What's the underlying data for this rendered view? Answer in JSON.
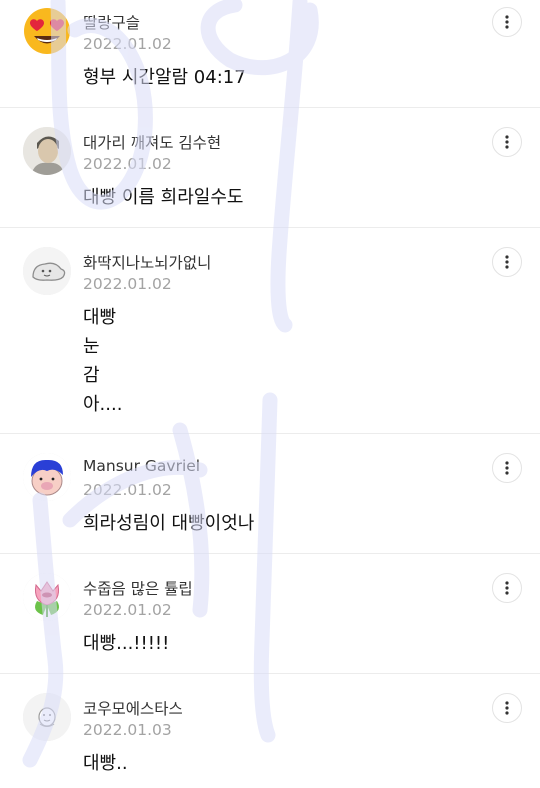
{
  "comments": [
    {
      "author": "딸랑구슬",
      "date": "2022.01.02",
      "text": "형부 시간알람 04:17",
      "avatar": "heart-eyes-emoji"
    },
    {
      "author": "대가리 깨져도 김수현",
      "date": "2022.01.02",
      "text": "대빵 이름 희라일수도",
      "avatar": "actor-photo"
    },
    {
      "author": "화딱지나노뇌가없니",
      "date": "2022.01.02",
      "text": "대빵\n눈\n감\n아....",
      "avatar": "cartoon-creature"
    },
    {
      "author": "Mansur Gavriel",
      "date": "2022.01.02",
      "text": "희라성림이 대빵이엇나",
      "avatar": "blue-hair-character"
    },
    {
      "author": "수줍음 많은 튤립",
      "date": "2022.01.02",
      "text": "대빵...!!!!!",
      "avatar": "tulip-character"
    },
    {
      "author": "코우모에스타스",
      "date": "2022.01.03",
      "text": "대빵..",
      "avatar": "default-avatar"
    }
  ],
  "more_icon": "more-vertical-icon",
  "overlay": {
    "color": "#d9dcf7"
  }
}
